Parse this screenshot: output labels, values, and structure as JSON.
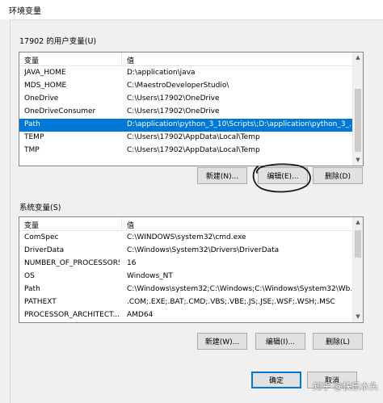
{
  "window": {
    "title": "环境变量"
  },
  "user_section": {
    "label": "17902 的用户变量(U)",
    "columns": [
      "变量",
      "值"
    ],
    "rows": [
      {
        "name": "JAVA_HOME",
        "value": "D:\\application\\java"
      },
      {
        "name": "MDS_HOME",
        "value": "C:\\MaestroDeveloperStudio\\"
      },
      {
        "name": "OneDrive",
        "value": "C:\\Users\\17902\\OneDrive"
      },
      {
        "name": "OneDriveConsumer",
        "value": "C:\\Users\\17902\\OneDrive"
      },
      {
        "name": "Path",
        "value": "D:\\application\\python_3_10\\Scripts\\;D:\\application\\python_3_..."
      },
      {
        "name": "TEMP",
        "value": "C:\\Users\\17902\\AppData\\Local\\Temp"
      },
      {
        "name": "TMP",
        "value": "C:\\Users\\17902\\AppData\\Local\\Temp"
      }
    ],
    "selected_index": 4,
    "buttons": {
      "new": "新建(N)...",
      "edit": "编辑(E)...",
      "delete": "删除(D)"
    }
  },
  "system_section": {
    "label": "系统变量(S)",
    "columns": [
      "变量",
      "值"
    ],
    "rows": [
      {
        "name": "ComSpec",
        "value": "C:\\WINDOWS\\system32\\cmd.exe"
      },
      {
        "name": "DriverData",
        "value": "C:\\Windows\\System32\\Drivers\\DriverData"
      },
      {
        "name": "NUMBER_OF_PROCESSORS",
        "value": "16"
      },
      {
        "name": "OS",
        "value": "Windows_NT"
      },
      {
        "name": "Path",
        "value": "C:\\Windows\\system32;C:\\Windows;C:\\Windows\\System32\\Wb..."
      },
      {
        "name": "PATHEXT",
        "value": ".COM;.EXE;.BAT;.CMD;.VBS;.VBE;.JS;.JSE;.WSF;.WSH;.MSC"
      },
      {
        "name": "PROCESSOR_ARCHITECT...",
        "value": "AMD64"
      }
    ],
    "buttons": {
      "new": "新建(W)...",
      "edit": "编辑(I)...",
      "delete": "删除(L)"
    }
  },
  "footer": {
    "ok": "确定",
    "cancel": "取消"
  },
  "watermark": "知乎 @快乐水头",
  "colors": {
    "selection": "#0078d7",
    "dialog_bg": "#f0f0f0",
    "ink": "#1a1a1a"
  }
}
